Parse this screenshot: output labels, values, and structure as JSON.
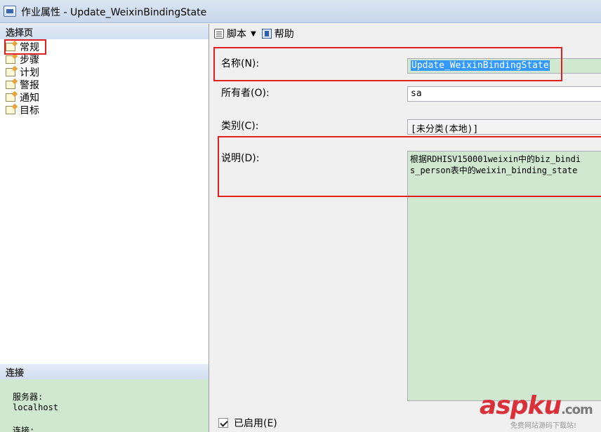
{
  "window": {
    "title": "作业属性 - Update_WeixinBindingState"
  },
  "left_pane": {
    "pages_header": "选择页",
    "pages": [
      {
        "label": "常规",
        "icon": "page-icon",
        "selected": true
      },
      {
        "label": "步骤",
        "icon": "page-icon",
        "selected": false
      },
      {
        "label": "计划",
        "icon": "page-icon",
        "selected": false
      },
      {
        "label": "警报",
        "icon": "page-icon",
        "selected": false
      },
      {
        "label": "通知",
        "icon": "page-icon",
        "selected": false
      },
      {
        "label": "目标",
        "icon": "page-icon",
        "selected": false
      }
    ],
    "connect_header": "连接",
    "server_label": "服务器:",
    "server_value": "localhost",
    "connection_label": "连接:"
  },
  "toolbar": {
    "script_label": "脚本",
    "help_label": "帮助"
  },
  "form": {
    "name_label": "名称(N):",
    "name_value": "Update_WeixinBindingState",
    "owner_label": "所有者(O):",
    "owner_value": "sa",
    "category_label": "类别(C):",
    "category_value": "[未分类(本地)]",
    "description_label": "说明(D):",
    "description_lines": [
      "根据RDHISV150001weixin中的biz_bindi",
      "s_person表中的weixin_binding_state"
    ],
    "enabled_label": "已启用(E)",
    "enabled_checked": true
  },
  "watermark": {
    "logo_asp": "asp",
    "logo_ku": "ku",
    "logo_com": ".com",
    "subtitle": "免费网站源码下载站!"
  },
  "colors": {
    "highlight_box": "#e02020",
    "field_green": "#cfe8cf",
    "selection_blue": "#3399ff"
  }
}
